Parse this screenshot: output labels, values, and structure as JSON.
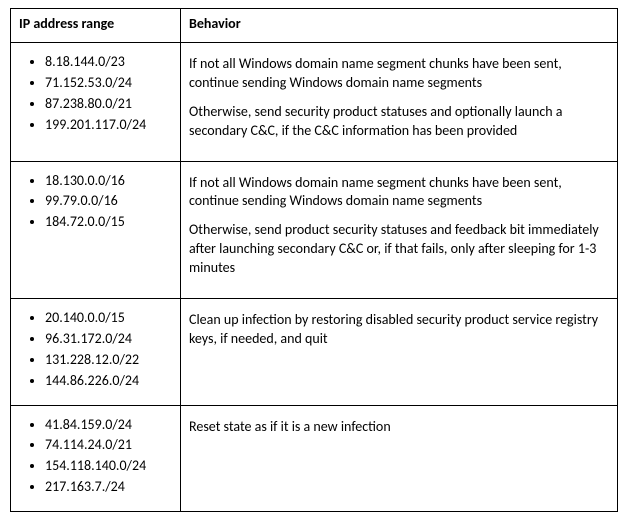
{
  "table": {
    "headers": {
      "ip_range": "IP address range",
      "behavior": "Behavior"
    },
    "rows": [
      {
        "ips": [
          "8.18.144.0/23",
          "71.152.53.0/24",
          "87.238.80.0/21",
          "199.201.117.0/24"
        ],
        "behavior_paragraphs": [
          "If not all Windows domain name segment chunks have been sent, continue sending Windows domain name segments",
          "Otherwise, send security product statuses and optionally launch a secondary C&C, if the C&C information has been provided"
        ]
      },
      {
        "ips": [
          "18.130.0.0/16",
          "99.79.0.0/16",
          "184.72.0.0/15"
        ],
        "behavior_paragraphs": [
          "If not all Windows domain name segment chunks have been sent, continue sending Windows domain name segments",
          "Otherwise, send product security statuses and feedback bit immediately after launching secondary C&C or, if that fails, only after sleeping for 1-3 minutes"
        ]
      },
      {
        "ips": [
          "20.140.0.0/15",
          "96.31.172.0/24",
          "131.228.12.0/22",
          "144.86.226.0/24"
        ],
        "behavior_paragraphs": [
          "Clean up infection by restoring disabled security product service registry keys, if needed, and quit"
        ]
      },
      {
        "ips": [
          "41.84.159.0/24",
          "74.114.24.0/21",
          "154.118.140.0/24",
          "217.163.7./24"
        ],
        "behavior_paragraphs": [
          "Reset state as if it is a new infection"
        ]
      }
    ]
  }
}
